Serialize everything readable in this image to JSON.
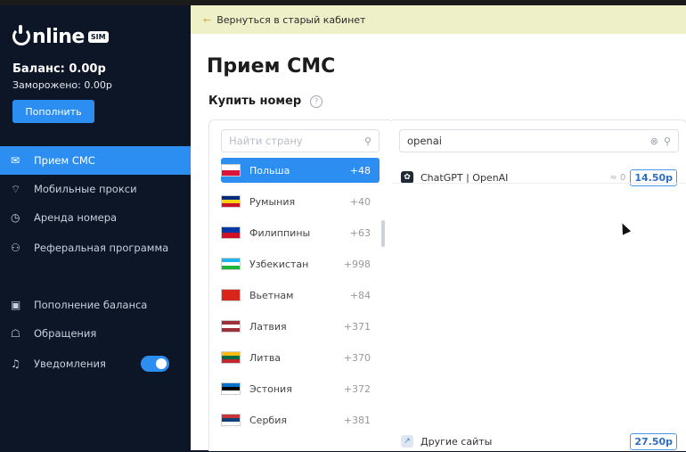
{
  "brand": {
    "name": "nline",
    "badge": "SIM"
  },
  "account": {
    "balance": "Баланс: 0.00р",
    "frozen": "Заморожено: 0.00р",
    "topup_label": "Пополнить"
  },
  "nav": [
    {
      "label": "Прием СМС",
      "icon": "message-icon",
      "active": true
    },
    {
      "label": "Мобильные прокси",
      "icon": "wifi-icon"
    },
    {
      "label": "Аренда номера",
      "icon": "clock-icon"
    },
    {
      "label": "Реферальная программа",
      "icon": "users-icon"
    },
    {
      "label": "Пополнение баланса",
      "icon": "wallet-icon"
    },
    {
      "label": "Обращения",
      "icon": "support-icon"
    },
    {
      "label": "Уведомления",
      "icon": "bell-icon",
      "toggle": true
    }
  ],
  "back_link": "Вернуться в старый кабинет",
  "page_title": "Прием СМС",
  "buy_label": "Купить номер",
  "country_search": {
    "placeholder": "Найти страну"
  },
  "service_search": {
    "value": "openai"
  },
  "countries": [
    {
      "name": "Польша",
      "code": "+48",
      "active": true,
      "flag": [
        "#ffffff",
        "#dc143c"
      ]
    },
    {
      "name": "Румыния",
      "code": "+40",
      "flag": [
        "#002b7f",
        "#fcd116",
        "#ce1126"
      ]
    },
    {
      "name": "Филиппины",
      "code": "+63",
      "flag": [
        "#0038a8",
        "#ce1126"
      ]
    },
    {
      "name": "Узбекистан",
      "code": "+998",
      "flag": [
        "#1eb5e8",
        "#ffffff",
        "#1eb53a"
      ]
    },
    {
      "name": "Вьетнам",
      "code": "+84",
      "flag": [
        "#da251d"
      ]
    },
    {
      "name": "Латвия",
      "code": "+371",
      "flag": [
        "#9e3039",
        "#ffffff",
        "#9e3039"
      ]
    },
    {
      "name": "Литва",
      "code": "+370",
      "flag": [
        "#fdb913",
        "#006a44",
        "#c1272d"
      ]
    },
    {
      "name": "Эстония",
      "code": "+372",
      "flag": [
        "#0072ce",
        "#000000",
        "#ffffff"
      ]
    },
    {
      "name": "Сербия",
      "code": "+381",
      "flag": [
        "#c6363c",
        "#0c4076",
        "#ffffff"
      ]
    }
  ],
  "services": [
    {
      "name": "ChatGPT | OpenAI",
      "qty": "≈ 0",
      "price": "14.50р"
    }
  ],
  "other": {
    "name": "Другие сайты",
    "price": "27.50р"
  }
}
